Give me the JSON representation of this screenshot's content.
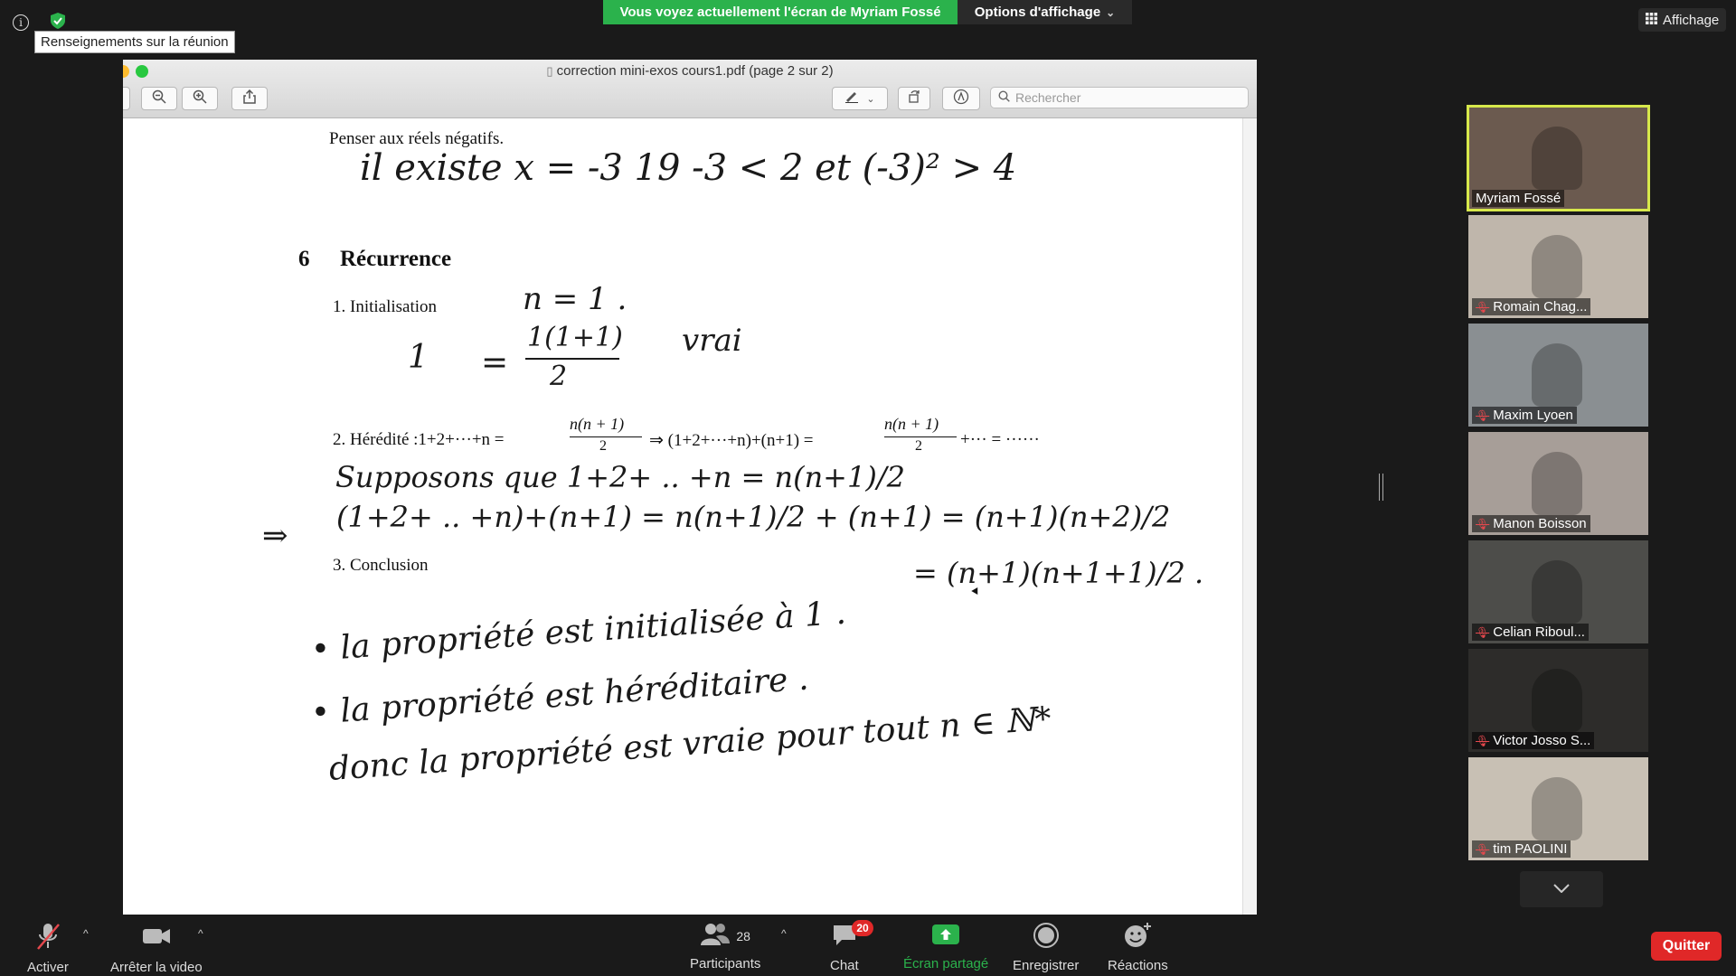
{
  "top": {
    "tooltip": "Renseignements sur la réunion",
    "share_banner": "Vous voyez actuellement l'écran de Myriam Fossé",
    "view_options": "Options d'affichage",
    "view_button": "Affichage"
  },
  "window": {
    "title": "correction mini-exos cours1.pdf (page 2 sur 2)",
    "search_placeholder": "Rechercher"
  },
  "page": {
    "line_negatifs": "Penser aux réels négatifs.",
    "hw_exists": "il existe x = -3   19   -3 < 2 et (-3)² > 4",
    "section_number": "6",
    "section_title": "Récurrence",
    "item1_label": "1. Initialisation",
    "hw_n1": "n = 1 .",
    "hw_init_lhs": "1",
    "hw_init_num": "1(1+1)",
    "hw_init_den": "2",
    "hw_vrai": "vrai",
    "item2_label": "2. Hérédité :1+2+···+n =",
    "item2_frac_num": "n(n + 1)",
    "item2_frac_den": "2",
    "item2_mid": "⇒ (1+2+···+n)+(n+1) =",
    "item2_tail": "+··· = ······",
    "hw_supposons": "Supposons que   1+2+ .. +n =  n(n+1)/2",
    "hw_implies": "⇒",
    "hw_step": "(1+2+ .. +n)+(n+1) =  n(n+1)/2 + (n+1)  =  (n+1)(n+2)/2",
    "item3_label": "3. Conclusion",
    "hw_step2": "=  (n+1)(n+1+1)/2 .",
    "hw_bullet1": "•  la propriété est initialisée à 1 .",
    "hw_bullet2": "•  la propriété est héréditaire .",
    "hw_donc": "donc  la propriété est vraie pour tout n ∈ ℕ*"
  },
  "participants": [
    {
      "name": "Myriam Fossé",
      "active": true,
      "muted": false,
      "bg": "#6b5a4f"
    },
    {
      "name": "Romain Chag...",
      "active": false,
      "muted": true,
      "bg": "#bfb6ab"
    },
    {
      "name": "Maxim Lyoen",
      "active": false,
      "muted": true,
      "bg": "#8a8f92"
    },
    {
      "name": "Manon Boisson",
      "active": false,
      "muted": true,
      "bg": "#a79e98"
    },
    {
      "name": "Celian Riboul...",
      "active": false,
      "muted": true,
      "bg": "#4d4d4a"
    },
    {
      "name": "Victor Josso S...",
      "active": false,
      "muted": true,
      "bg": "#2d2c2a"
    },
    {
      "name": "tim PAOLINI",
      "active": false,
      "muted": true,
      "bg": "#c8c0b4"
    }
  ],
  "controls": {
    "mic_label": "Activer",
    "video_label": "Arrêter la video",
    "participants_label": "Participants",
    "participants_count": "28",
    "chat_label": "Chat",
    "chat_badge": "20",
    "share_label": "Écran partagé",
    "record_label": "Enregistrer",
    "reactions_label": "Réactions",
    "leave_label": "Quitter"
  },
  "colors": {
    "share_green": "#2bb24c",
    "leave_red": "#e02828",
    "active_speaker": "#d7e84b"
  }
}
